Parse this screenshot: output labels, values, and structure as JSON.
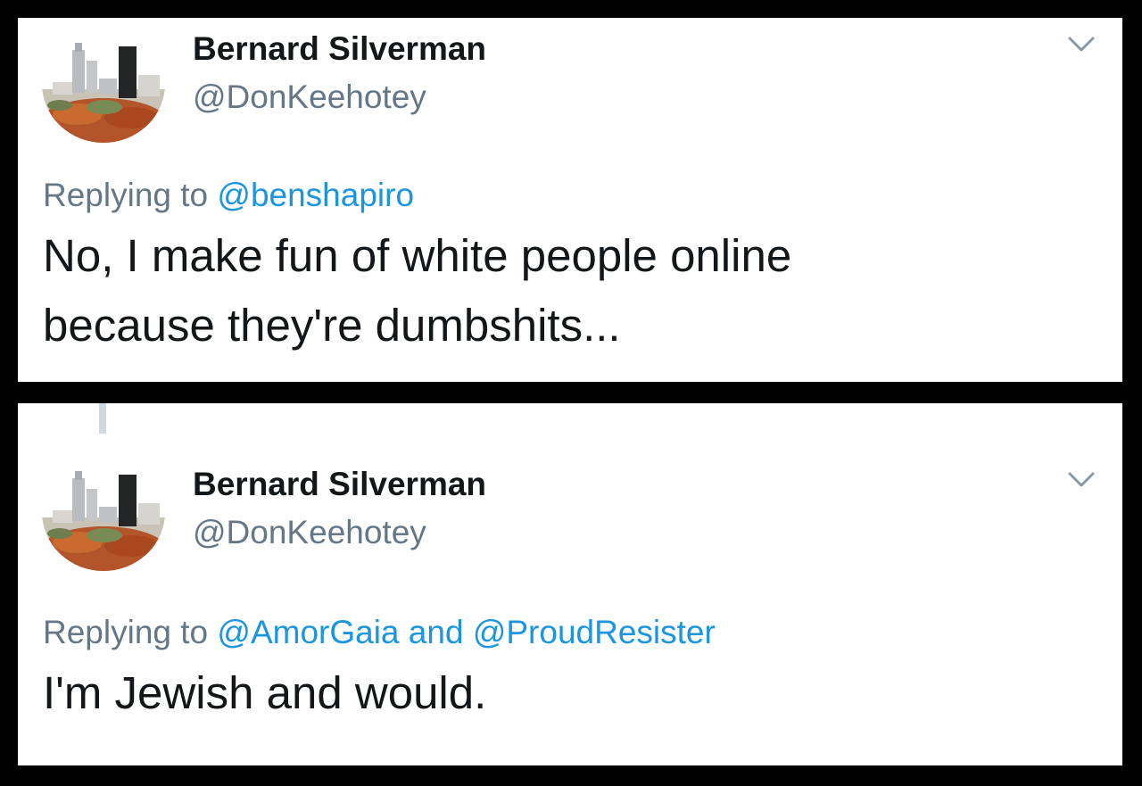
{
  "tweets": [
    {
      "display_name": "Bernard Silverman",
      "handle": "@DonKeehotey",
      "replying_prefix": "Replying to ",
      "mentions": [
        "@benshapiro"
      ],
      "mention_joiner": "",
      "text_lines": [
        "No, I make fun of white people online",
        "because they're dumbshits..."
      ],
      "menu_icon": "chevron-down-icon",
      "avatar_icon": "city-skyline-avatar"
    },
    {
      "display_name": "Bernard Silverman",
      "handle": "@DonKeehotey",
      "replying_prefix": "Replying to ",
      "mentions": [
        "@AmorGaia",
        "@ProudResister"
      ],
      "mention_joiner": " and ",
      "text_lines": [
        "I'm Jewish and would."
      ],
      "menu_icon": "chevron-down-icon",
      "avatar_icon": "city-skyline-avatar"
    }
  ],
  "colors": {
    "background": "#000000",
    "card": "#ffffff",
    "name": "#14171a",
    "handle": "#657786",
    "mention": "#1b95e0",
    "thread_line": "#cfd9de"
  }
}
